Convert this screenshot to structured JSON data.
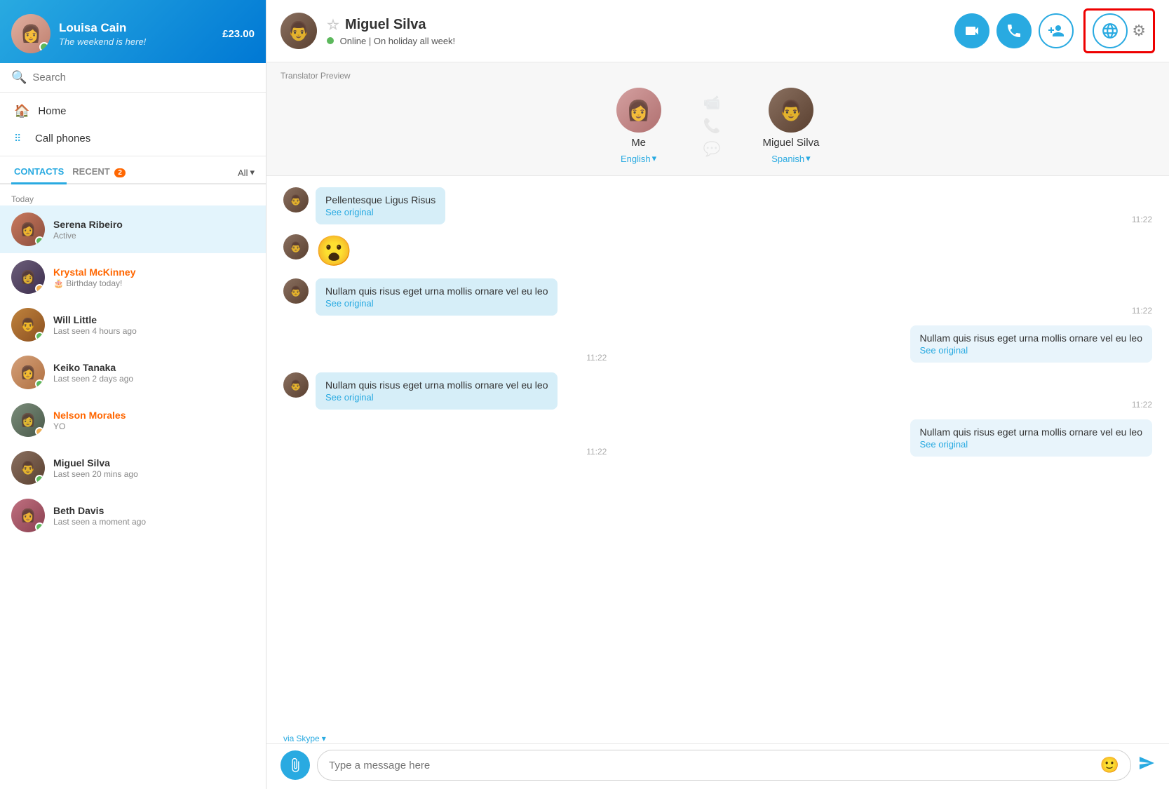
{
  "sidebar": {
    "profile": {
      "name": "Louisa Cain",
      "status": "The weekend is here!",
      "balance": "£23.00",
      "avatar_label": "Louisa"
    },
    "search": {
      "placeholder": "Search"
    },
    "nav": [
      {
        "id": "home",
        "icon": "🏠",
        "label": "Home"
      },
      {
        "id": "call-phones",
        "icon": "⠿",
        "label": "Call phones"
      }
    ],
    "tabs": [
      {
        "id": "contacts",
        "label": "CONTACTS",
        "active": true
      },
      {
        "id": "recent",
        "label": "RECENT",
        "badge": "2",
        "active": false
      }
    ],
    "tab_all_label": "All",
    "section_today": "Today",
    "contacts": [
      {
        "id": "serena",
        "name": "Serena Ribeiro",
        "sub": "Active",
        "status_color": "dot-green",
        "name_class": "",
        "avatar_class": "av-serena"
      },
      {
        "id": "krystal",
        "name": "Krystal McKinney",
        "sub": "🎂 Birthday today!",
        "status_color": "dot-yellow",
        "name_class": "orange",
        "avatar_class": "av-krystal"
      },
      {
        "id": "will",
        "name": "Will Little",
        "sub": "Last seen 4 hours ago",
        "status_color": "dot-green",
        "name_class": "",
        "avatar_class": "av-will"
      },
      {
        "id": "keiko",
        "name": "Keiko Tanaka",
        "sub": "Last seen 2 days ago",
        "status_color": "dot-green",
        "name_class": "",
        "avatar_class": "av-keiko"
      },
      {
        "id": "nelson",
        "name": "Nelson Morales",
        "sub": "YO",
        "status_color": "dot-yellow",
        "name_class": "orange",
        "avatar_class": "av-nelson"
      },
      {
        "id": "miguel",
        "name": "Miguel Silva",
        "sub": "Last seen 20 mins ago",
        "status_color": "dot-green",
        "name_class": "",
        "avatar_class": "av-miguel"
      },
      {
        "id": "beth",
        "name": "Beth Davis",
        "sub": "Last seen a moment ago",
        "status_color": "dot-green",
        "name_class": "",
        "avatar_class": "av-beth"
      }
    ]
  },
  "chat": {
    "contact_name": "Miguel Silva",
    "contact_status": "Online",
    "contact_status_extra": "On holiday all week!",
    "avatar_class": "av-miguel",
    "header_buttons": {
      "video": "📹",
      "call": "📞",
      "add_contact": "➕"
    },
    "translator_label": "Translator Preview",
    "me": {
      "name": "Me",
      "lang": "English",
      "avatar_class": "av-me"
    },
    "them": {
      "name": "Miguel Silva",
      "lang": "Spanish",
      "avatar_class": "av-miguel"
    },
    "messages": [
      {
        "id": "m1",
        "side": "left",
        "text": "Pellentesque Ligus Risus",
        "see_original": "See original",
        "time": "11:22"
      },
      {
        "id": "m2",
        "side": "left",
        "emoji": "😮",
        "text": "",
        "time": ""
      },
      {
        "id": "m3",
        "side": "left",
        "text": "Nullam quis risus eget urna mollis ornare vel eu leo",
        "see_original": "See original",
        "time": "11:22"
      },
      {
        "id": "m4",
        "side": "right",
        "text": "Nullam quis risus eget urna mollis ornare vel eu leo",
        "see_original": "See original",
        "time": "11:22"
      },
      {
        "id": "m5",
        "side": "left",
        "text": "Nullam quis risus eget urna mollis ornare vel eu leo",
        "see_original": "See original",
        "time": "11:22"
      },
      {
        "id": "m6",
        "side": "right",
        "text": "Nullam quis risus eget urna mollis ornare vel eu leo",
        "see_original": "See original",
        "time": "11:22"
      }
    ],
    "via_label": "via",
    "via_service": "Skype",
    "input_placeholder": "Type a message here"
  },
  "toolbar": {
    "translator_icon": "🌐",
    "gear_icon": "⚙"
  }
}
